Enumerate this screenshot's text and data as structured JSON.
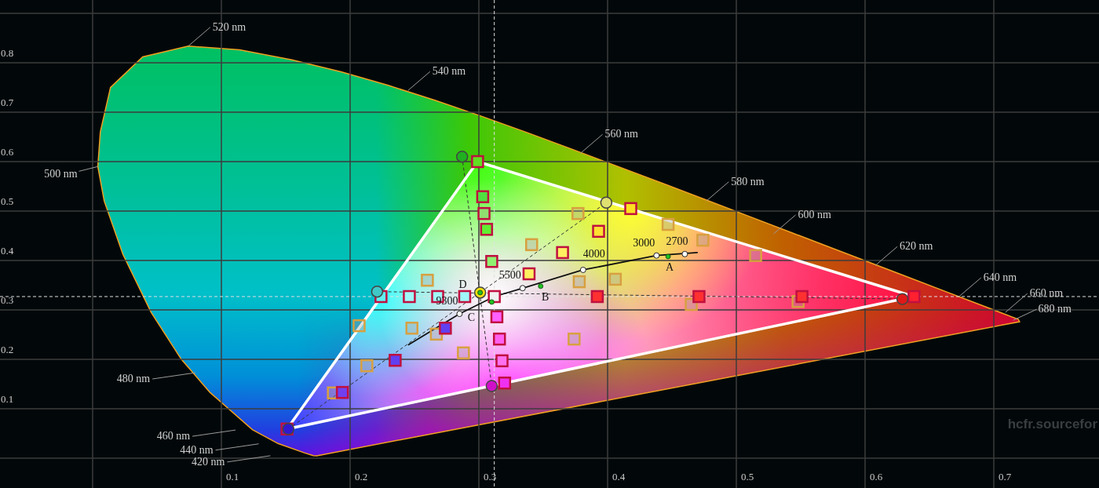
{
  "diagram": {
    "x_axis_ticks": [
      "0.1",
      "0.2",
      "0.3",
      "0.4",
      "0.5",
      "0.6",
      "0.7"
    ],
    "y_axis_ticks": [
      "0.8",
      "0.7",
      "0.6",
      "0.5",
      "0.4",
      "0.3",
      "0.2",
      "0.1"
    ],
    "wavelength_labels": [
      "520 nm",
      "540 nm",
      "560 nm",
      "580 nm",
      "600 nm",
      "620 nm",
      "640 nm",
      "660 nm",
      "680 nm",
      "500 nm",
      "480 nm",
      "460 nm",
      "440 nm",
      "420 nm"
    ],
    "temperature_labels": [
      "9300",
      "5500",
      "4000",
      "3000",
      "2700"
    ],
    "illuminant_labels": [
      "A",
      "B",
      "C",
      "D"
    ]
  },
  "site_label": "hcfr.sourcefor"
}
